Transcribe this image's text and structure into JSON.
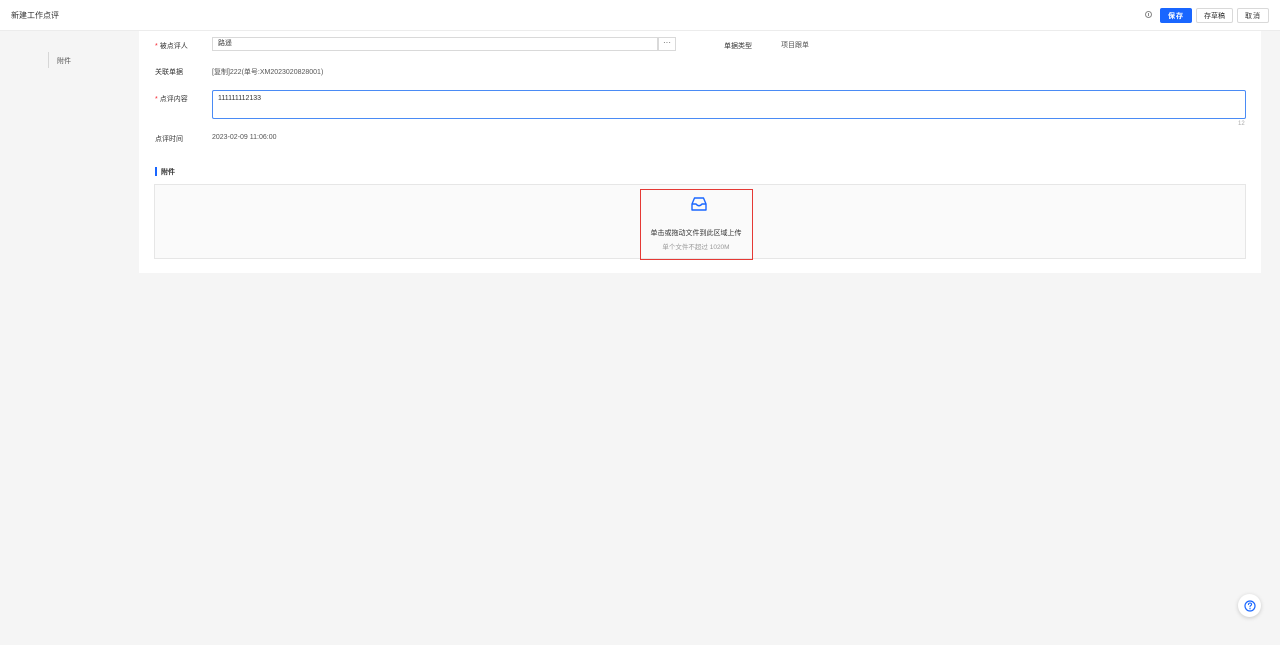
{
  "header": {
    "title": "新建工作点评",
    "save_label": "保存",
    "draft_label": "存草稿",
    "cancel_label": "取消"
  },
  "side_nav": {
    "items": [
      {
        "label": "附件"
      }
    ]
  },
  "form": {
    "required_mark": "*",
    "reviewee_label": "被点评人",
    "reviewee_value": "路遥",
    "more_label": "···",
    "doc_type_label": "单据类型",
    "doc_type_value": "项目跟单",
    "related_doc_label": "关联单据",
    "related_doc_value": "[复制]222(单号:XM2023020828001)",
    "content_label": "点评内容",
    "content_value": "111111112133",
    "content_count": "12",
    "time_label": "点评时间",
    "time_value": "2023-02-09 11:06:00"
  },
  "attachment": {
    "section_title": "附件",
    "upload_text": "单击或拖动文件到此区域上传",
    "upload_hint": "单个文件不超过 1020M"
  },
  "colors": {
    "primary": "#1966ff",
    "required": "#f5222d",
    "highlight": "#e53935"
  }
}
